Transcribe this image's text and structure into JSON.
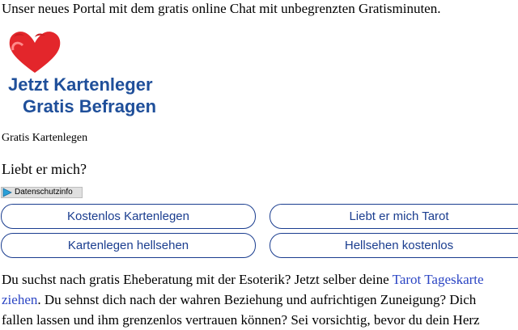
{
  "intro": "Unser neues Portal mit dem gratis online Chat mit unbegrenzten Gratisminuten.",
  "logo": {
    "line1": "Jetzt Kartenleger",
    "line2": "Gratis Befragen",
    "colors": {
      "text": "#1f4f9a",
      "hearts": "#e3262b"
    }
  },
  "caption": "Gratis Kartenlegen",
  "question": "Liebt er mich?",
  "privacy_label": "Datenschutzinfo",
  "nav_buttons": [
    {
      "label": "Kostenlos Kartenlegen"
    },
    {
      "label": "Liebt er mich Tarot"
    },
    {
      "label": "Kartenlegen hellsehen"
    },
    {
      "label": "Hellsehen kostenlos"
    }
  ],
  "body": {
    "line1_text": "Du suchst nach gratis Eheberatung mit der Esoterik? Jetzt selber deine ",
    "link_part1": "Tarot Tageskarte",
    "link_part2": "ziehen",
    "line2_text": ". Du sehnst dich nach der wahren Beziehung und aufrichtigen Zuneigung? Dich",
    "line3_text": "fallen lassen und ihm grenzenlos vertrauen können? Sei vorsichtig, bevor du dein Herz"
  },
  "colors": {
    "accent": "#1a3d8f",
    "link": "#2b45c4"
  }
}
